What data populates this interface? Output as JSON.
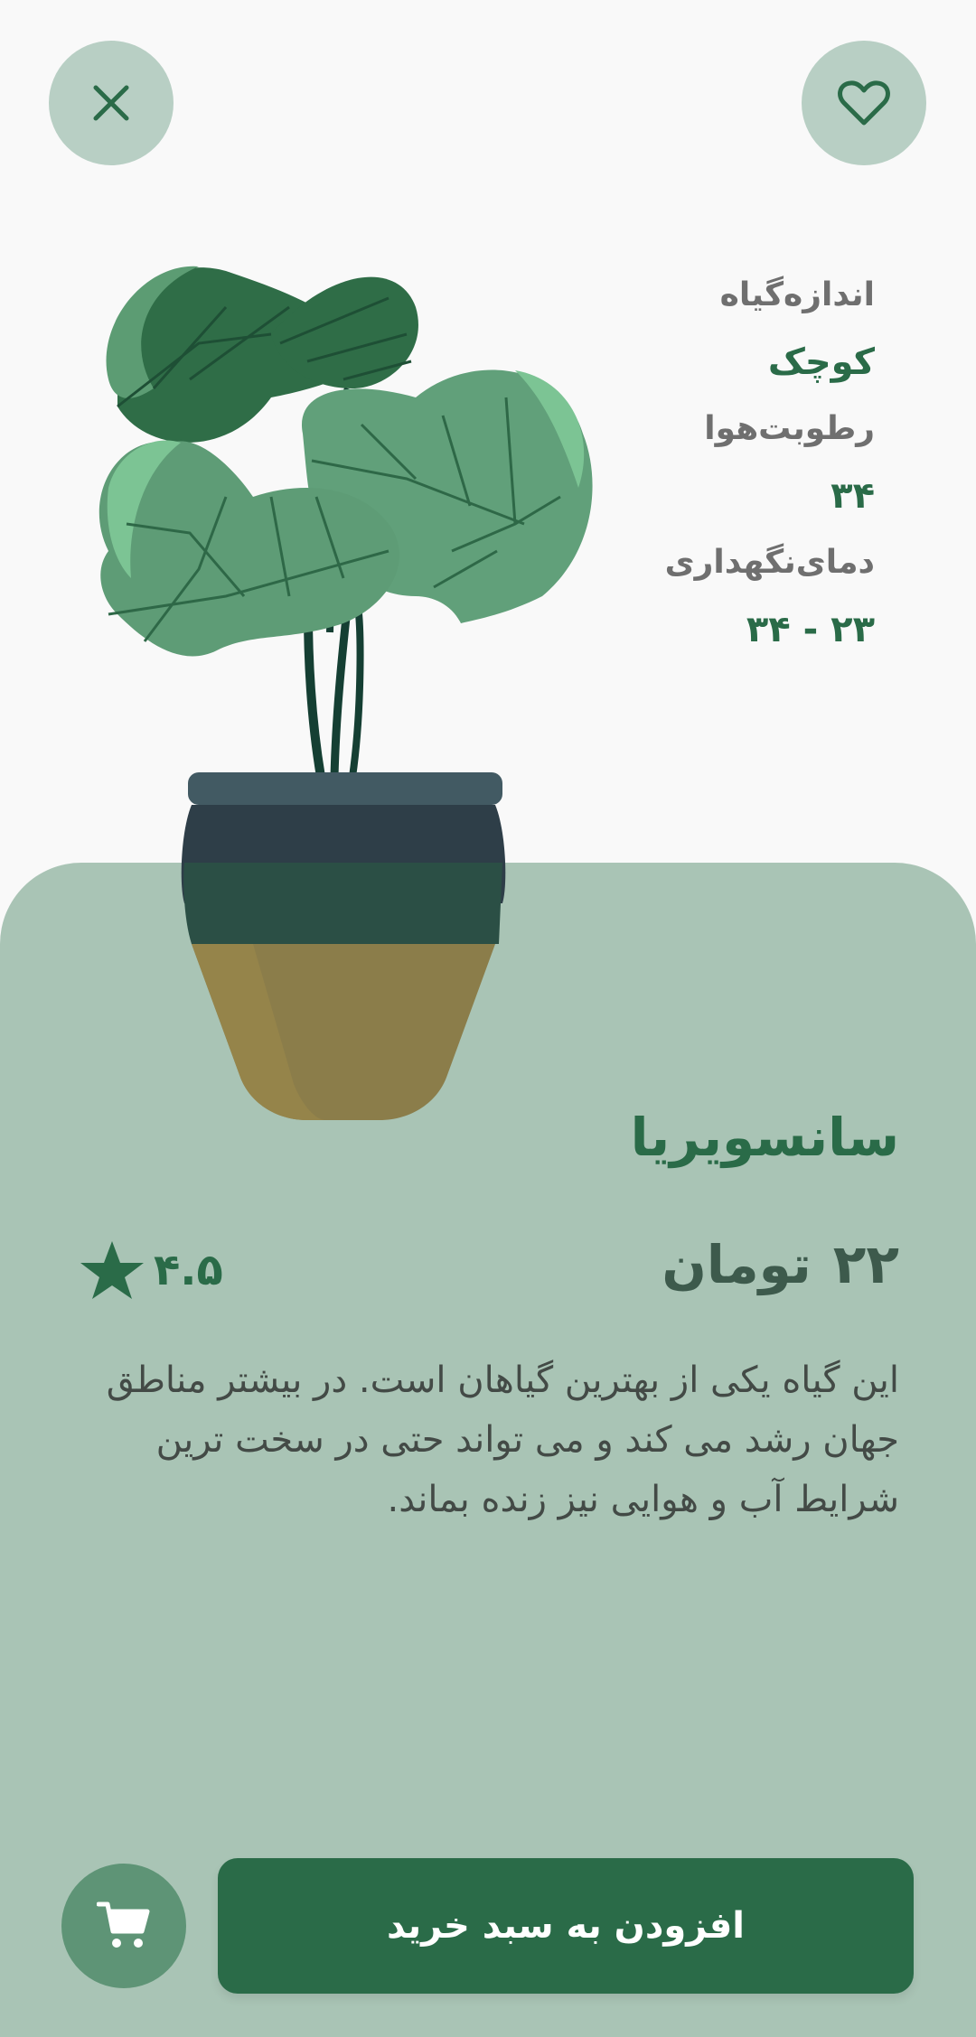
{
  "header": {
    "close_icon": "close-icon",
    "favorite_icon": "heart-icon"
  },
  "specs": {
    "size_label": "اندازه‌گیاه",
    "size_value": "کوچک",
    "humidity_label": "رطوبت‌هوا",
    "humidity_value": "۳۴",
    "temperature_label": "دمای‌نگهداری",
    "temperature_value": "۲۳ - ۳۴"
  },
  "product": {
    "name": "سانسویریا",
    "price": "۲۲",
    "currency": "تومان",
    "rating": "۴.۵",
    "description": "این گیاه یکی از بهترین گیاهان است. در بیشتر مناطق جهان رشد می کند و می تواند حتی در سخت ترین شرایط آب و هوایی نیز زنده بماند."
  },
  "actions": {
    "add_to_cart_label": "افزودن به سبد خرید",
    "cart_icon": "cart-icon"
  },
  "colors": {
    "background": "#f9f9f9",
    "card": "#a9c4b5",
    "primary": "#2a6b48",
    "circle_button": "#b8cfc4"
  }
}
